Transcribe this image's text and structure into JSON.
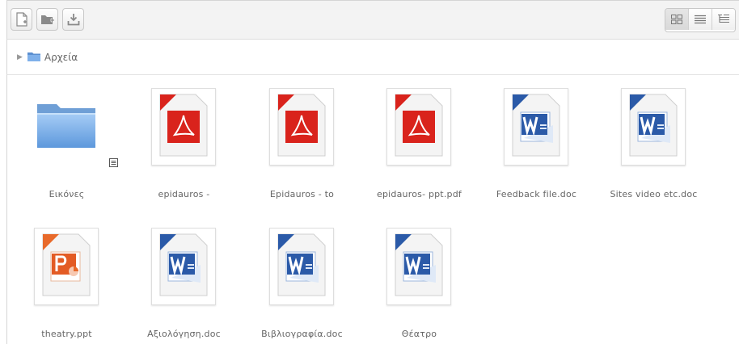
{
  "toolbar": {
    "buttons": [
      {
        "name": "new-file-icon"
      },
      {
        "name": "new-folder-icon"
      },
      {
        "name": "download-icon"
      }
    ],
    "view_modes": [
      "icon-view-icon",
      "list-view-icon",
      "tree-view-icon"
    ]
  },
  "breadcrumb": {
    "label": "Αρχεία"
  },
  "files": [
    {
      "name": "Εικόνες",
      "type": "folder"
    },
    {
      "name": "epidauros -",
      "type": "pdf"
    },
    {
      "name": "Epidauros - to",
      "type": "pdf"
    },
    {
      "name": "epidauros- ppt.pdf",
      "type": "pdf"
    },
    {
      "name": "Feedback file.doc",
      "type": "doc"
    },
    {
      "name": "Sites video etc.doc",
      "type": "doc"
    },
    {
      "name": "theatry.ppt",
      "type": "ppt"
    },
    {
      "name": "Αξιολόγηση.doc",
      "type": "doc"
    },
    {
      "name": "Βιβλιογραφία.doc",
      "type": "doc"
    },
    {
      "name": "Θέατρο",
      "type": "doc"
    }
  ],
  "colors": {
    "pdf_red": "#d9231c",
    "word_blue": "#2b5aa8",
    "ppt_orange": "#e86a2b",
    "folder_blue": "#6aa6e8"
  }
}
